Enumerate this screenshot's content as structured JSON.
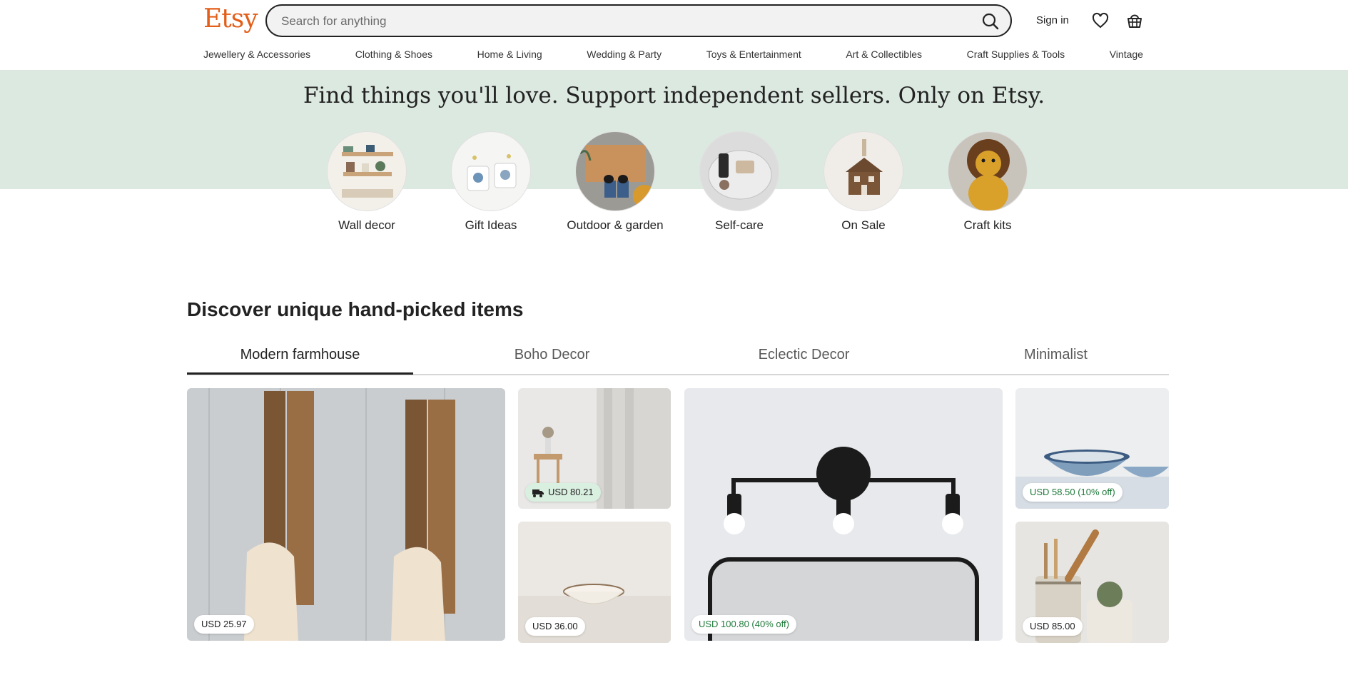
{
  "header": {
    "logo": "Etsy",
    "search_placeholder": "Search for anything",
    "sign_in": "Sign in",
    "icons": [
      "search-icon",
      "heart-icon",
      "basket-icon"
    ]
  },
  "nav": {
    "items": [
      {
        "label": "Jewellery & Accessories"
      },
      {
        "label": "Clothing & Shoes"
      },
      {
        "label": "Home & Living"
      },
      {
        "label": "Wedding & Party"
      },
      {
        "label": "Toys & Entertainment"
      },
      {
        "label": "Art & Collectibles"
      },
      {
        "label": "Craft Supplies & Tools"
      },
      {
        "label": "Vintage"
      }
    ]
  },
  "hero": {
    "title": "Find things you'll love. Support independent sellers. Only on Etsy."
  },
  "categories": [
    {
      "label": "Wall decor"
    },
    {
      "label": "Gift Ideas"
    },
    {
      "label": "Outdoor & garden"
    },
    {
      "label": "Self-care"
    },
    {
      "label": "On Sale"
    },
    {
      "label": "Craft kits"
    }
  ],
  "discover": {
    "title": "Discover unique hand-picked items",
    "tabs": [
      {
        "label": "Modern farmhouse",
        "active": true
      },
      {
        "label": "Boho Decor",
        "active": false
      },
      {
        "label": "Eclectic Decor",
        "active": false
      },
      {
        "label": "Minimalist",
        "active": false
      }
    ],
    "items": [
      {
        "price": "USD 25.97",
        "sale": false,
        "free_shipping": false
      },
      {
        "price": "USD 80.21",
        "sale": false,
        "free_shipping": true
      },
      {
        "price": "USD 36.00",
        "sale": false,
        "free_shipping": false
      },
      {
        "price": "USD 100.80 (40% off)",
        "sale": true,
        "free_shipping": false
      },
      {
        "price": "USD 58.50 (10% off)",
        "sale": true,
        "free_shipping": false
      },
      {
        "price": "USD 85.00",
        "sale": false,
        "free_shipping": false
      }
    ]
  },
  "colors": {
    "brand": "#e35e19",
    "hero_band": "#dce9e1",
    "sale_text": "#1f7a3a"
  }
}
